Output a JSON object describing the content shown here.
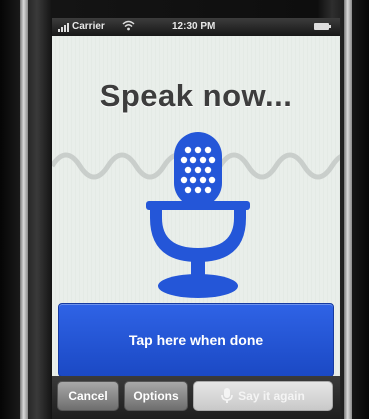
{
  "status_bar": {
    "carrier": "Carrier",
    "time": "12:30 PM",
    "signal_icon": "signal-bars-icon",
    "wifi_icon": "wifi-icon",
    "battery_icon": "battery-icon"
  },
  "main": {
    "headline": "Speak now...",
    "mic_icon": "microphone-icon",
    "done_button_label": "Tap here when done"
  },
  "toolbar": {
    "cancel_label": "Cancel",
    "options_label": "Options",
    "say_again_label": "Say it again",
    "say_again_icon": "microphone-icon"
  },
  "colors": {
    "accent_blue": "#2456d8",
    "screen_bg": "#e9eeea",
    "wave": "#c9cecb",
    "headline": "#3d3d3d"
  }
}
